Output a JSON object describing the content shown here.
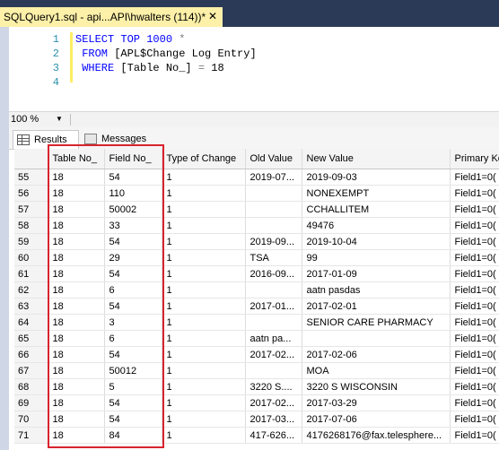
{
  "tab": {
    "title": "SQLQuery1.sql - api...API\\hwalters (114))*",
    "close": "✕"
  },
  "editor": {
    "lines": [
      {
        "num": "1",
        "tokens": [
          {
            "text": "SELECT TOP 1000 ",
            "style": "kw"
          },
          {
            "text": "*",
            "style": "gray"
          }
        ]
      },
      {
        "num": "2",
        "tokens": [
          {
            "text": " FROM ",
            "style": "kw"
          },
          {
            "text": "[APL$Change Log Entry]",
            "style": "black"
          }
        ]
      },
      {
        "num": "3",
        "tokens": [
          {
            "text": " WHERE ",
            "style": "kw"
          },
          {
            "text": "[Table No_] ",
            "style": "black"
          },
          {
            "text": "=",
            "style": "gray"
          },
          {
            "text": " 18",
            "style": "black"
          }
        ]
      },
      {
        "num": "4",
        "tokens": []
      }
    ]
  },
  "zoom": {
    "value": "100 %"
  },
  "results_tabs": {
    "results": "Results",
    "messages": "Messages"
  },
  "columns": [
    "",
    "Table No_",
    "Field No_",
    "Type of Change",
    "Old Value",
    "New Value",
    "Primary Ke"
  ],
  "rows": [
    [
      "55",
      "18",
      "54",
      "1",
      "2019-07...",
      "2019-09-03",
      "Field1=0("
    ],
    [
      "56",
      "18",
      "110",
      "1",
      "",
      "NONEXEMPT",
      "Field1=0("
    ],
    [
      "57",
      "18",
      "50002",
      "1",
      "",
      "CCHALLITEM",
      "Field1=0("
    ],
    [
      "58",
      "18",
      "33",
      "1",
      "",
      "49476",
      "Field1=0("
    ],
    [
      "59",
      "18",
      "54",
      "1",
      "2019-09...",
      "2019-10-04",
      "Field1=0("
    ],
    [
      "60",
      "18",
      "29",
      "1",
      "TSA",
      "99",
      "Field1=0("
    ],
    [
      "61",
      "18",
      "54",
      "1",
      "2016-09...",
      "2017-01-09",
      "Field1=0("
    ],
    [
      "62",
      "18",
      "6",
      "1",
      "",
      "aatn pasdas",
      "Field1=0("
    ],
    [
      "63",
      "18",
      "54",
      "1",
      "2017-01...",
      "2017-02-01",
      "Field1=0("
    ],
    [
      "64",
      "18",
      "3",
      "1",
      "",
      "SENIOR CARE PHARMACY",
      "Field1=0("
    ],
    [
      "65",
      "18",
      "6",
      "1",
      "aatn pa...",
      "",
      "Field1=0("
    ],
    [
      "66",
      "18",
      "54",
      "1",
      "2017-02...",
      "2017-02-06",
      "Field1=0("
    ],
    [
      "67",
      "18",
      "50012",
      "1",
      "",
      "MOA",
      "Field1=0("
    ],
    [
      "68",
      "18",
      "5",
      "1",
      "3220 S....",
      "3220 S WISCONSIN",
      "Field1=0("
    ],
    [
      "69",
      "18",
      "54",
      "1",
      "2017-02...",
      "2017-03-29",
      "Field1=0("
    ],
    [
      "70",
      "18",
      "54",
      "1",
      "2017-03...",
      "2017-07-06",
      "Field1=0("
    ],
    [
      "71",
      "18",
      "84",
      "1",
      "417-626...",
      "4176268176@fax.telesphere...",
      "Field1=0("
    ]
  ],
  "colors": {
    "tab_bg": "#2b3a57",
    "active_tab": "#fdf0a8",
    "keyword": "#0000ff",
    "highlight_box": "#d9232e"
  }
}
